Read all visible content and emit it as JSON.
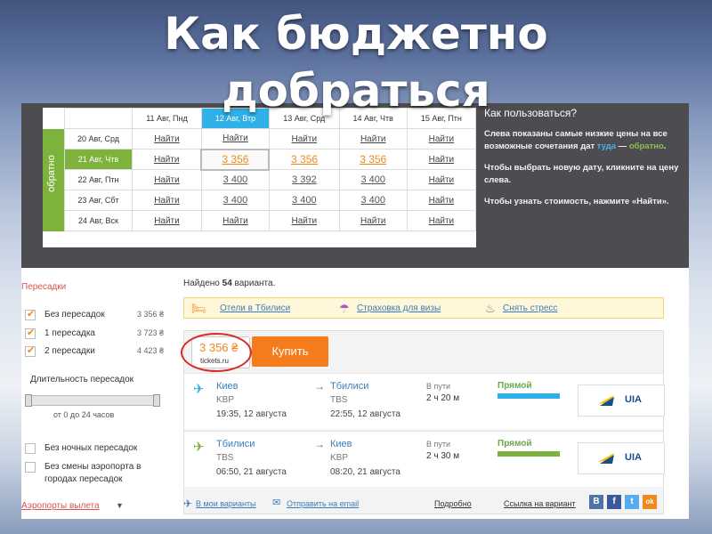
{
  "slide": {
    "title_line1": "Как бюджетно",
    "title_line2": "добраться"
  },
  "grid": {
    "side_label": "обратно",
    "columns": [
      "11 Авг, Пнд",
      "12 Авг, Втр",
      "13 Авг, Срд",
      "14 Авг, Чтв",
      "15 Авг, Птн"
    ],
    "rows": [
      {
        "date": "20 Авг, Срд",
        "cells": [
          "Найти",
          "Найти",
          "Найти",
          "Найти",
          "Найти"
        ]
      },
      {
        "date": "21 Авг, Чтв",
        "cells": [
          "Найти",
          "3 356",
          "3 356",
          "3 356",
          "Найти"
        ]
      },
      {
        "date": "22 Авг, Птн",
        "cells": [
          "Найти",
          "3 400",
          "3 392",
          "3 400",
          "Найти"
        ]
      },
      {
        "date": "23 Авг, Сбт",
        "cells": [
          "Найти",
          "3 400",
          "3 400",
          "3 400",
          "Найти"
        ]
      },
      {
        "date": "24 Авг, Вск",
        "cells": [
          "Найти",
          "Найти",
          "Найти",
          "Найти",
          "Найти"
        ]
      }
    ]
  },
  "help": {
    "heading": "Как пользоваться?",
    "p1": "Слева показаны самые низкие цены на все возможные сочетания дат",
    "p1_there": "туда",
    "p1_dash": " — ",
    "p1_back": "обратно",
    "p1_end": ".",
    "p2": "Чтобы выбрать новую дату, кликните на цену слева.",
    "p3": "Чтобы узнать стоимость, нажмите «Найти»."
  },
  "filters": {
    "transfers_title": "Пересадки",
    "options": [
      {
        "label": "Без пересадок",
        "price": "3 356 ₴",
        "checked": true
      },
      {
        "label": "1 пересадка",
        "price": "3 723 ₴",
        "checked": true
      },
      {
        "label": "2 пересадки",
        "price": "4 423 ₴",
        "checked": true
      }
    ],
    "duration_label": "Длительность пересадок",
    "duration_range": "от 0 до 24 часов",
    "no_night": "Без ночных пересадок",
    "no_airport_change": "Без смены аэропорта в городах пересадок",
    "airports": "Аэропорты вылета",
    "airports_arrow": "▼"
  },
  "results": {
    "found_prefix": "Найдено ",
    "found_count": "54",
    "found_suffix": " варианта.",
    "promo": [
      "Отели в Тбилиси",
      "Страховка для визы",
      "Снять стресс"
    ],
    "price": "3 356 ₴",
    "seller": "tickets.ru",
    "buy": "Купить",
    "segments": [
      {
        "from_city": "Киев",
        "from_code": "KBP",
        "from_time": "19:35, 12 августа",
        "to_city": "Тбилиси",
        "to_code": "TBS",
        "to_time": "22:55, 12 августа",
        "in_way": "В пути",
        "duration": "2 ч 20 м",
        "type": "Прямой",
        "airline": "UIA",
        "bar_color": "#2fb0e6",
        "plane_color": "#2fb0e6"
      },
      {
        "from_city": "Тбилиси",
        "from_code": "TBS",
        "from_time": "06:50, 21 августа",
        "to_city": "Киев",
        "to_code": "KBP",
        "to_time": "08:20, 21 августа",
        "in_way": "В пути",
        "duration": "2 ч 30 м",
        "type": "Прямой",
        "airline": "UIA",
        "bar_color": "#7db33c",
        "plane_color": "#7db33c"
      }
    ],
    "footer": {
      "my_variants": "В мои варианты",
      "send_email": "Отправить на email",
      "details": "Подробно",
      "link": "Ссылка на вариант",
      "social": [
        "В",
        "f",
        "t",
        "ok"
      ]
    }
  }
}
